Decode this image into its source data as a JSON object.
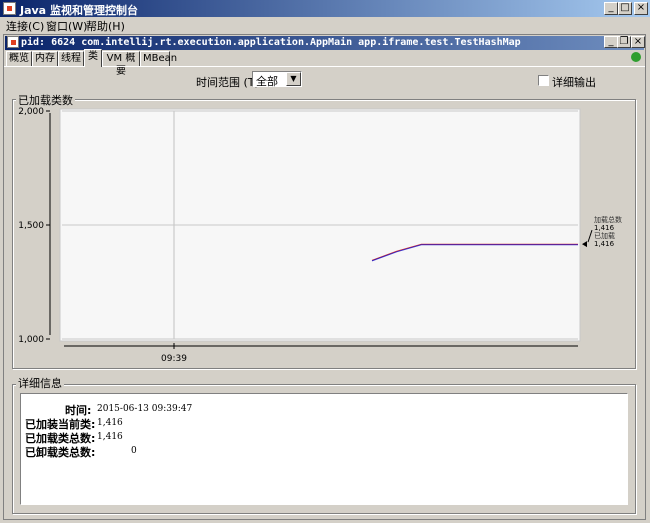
{
  "window": {
    "title": "Java 监视和管理控制台",
    "controls": [
      "_",
      "□",
      "×"
    ]
  },
  "menu": [
    {
      "label": "连接(C)"
    },
    {
      "label": "窗口(W)"
    },
    {
      "label": "帮助(H)"
    }
  ],
  "inner_window": {
    "title": "pid: 6624 com.intellij.rt.execution.application.AppMain app.iframe.test.TestHashMap",
    "controls": [
      "_",
      "❐",
      "×"
    ]
  },
  "tabs": [
    {
      "label": "概览",
      "active": false
    },
    {
      "label": "内存",
      "active": false
    },
    {
      "label": "线程",
      "active": false
    },
    {
      "label": "类",
      "active": true
    },
    {
      "label": "VM 概要",
      "active": false
    },
    {
      "label": "MBean",
      "active": false
    }
  ],
  "toolbar": {
    "time_range_label": "时间范围 (T):",
    "time_range_value": "全部",
    "verbose_label": "详细输出",
    "verbose_checked": false
  },
  "chart_panel": {
    "title": "已加载类数"
  },
  "chart_data": {
    "type": "line",
    "ylim": [
      1000,
      2000
    ],
    "yticks": [
      "2,000",
      "1,500",
      "1,000"
    ],
    "xticks": [
      "09:39"
    ],
    "series": [
      {
        "name": "加载总数",
        "color": "#cc0000",
        "x": [
          0,
          0.12,
          0.24,
          0.4,
          0.7,
          1.0
        ],
        "values": [
          1345,
          1385,
          1416,
          1416,
          1416,
          1416
        ]
      },
      {
        "name": "已加载",
        "color": "#0000cc",
        "x": [
          0,
          0.12,
          0.24,
          0.4,
          0.7,
          1.0
        ],
        "values": [
          1345,
          1385,
          1416,
          1416,
          1416,
          1416
        ]
      }
    ],
    "legend": [
      {
        "name": "加载总数",
        "value": "1,416"
      },
      {
        "name": "已加载",
        "value": "1,416"
      }
    ]
  },
  "details": {
    "title": "详细信息",
    "rows": [
      {
        "label": "时间:",
        "value": "2015-06-13 09:39:47"
      },
      {
        "label": "已加装当前类:",
        "value": "1,416"
      },
      {
        "label": "已加载类总数:",
        "value": "1,416"
      },
      {
        "label": "已卸载类总数:",
        "value": "0"
      }
    ]
  },
  "colors": {
    "title_bar": "#0a246a",
    "chart_bg": "#f7f7f7",
    "series_total": "#cc0000",
    "series_loaded": "#0000cc"
  }
}
